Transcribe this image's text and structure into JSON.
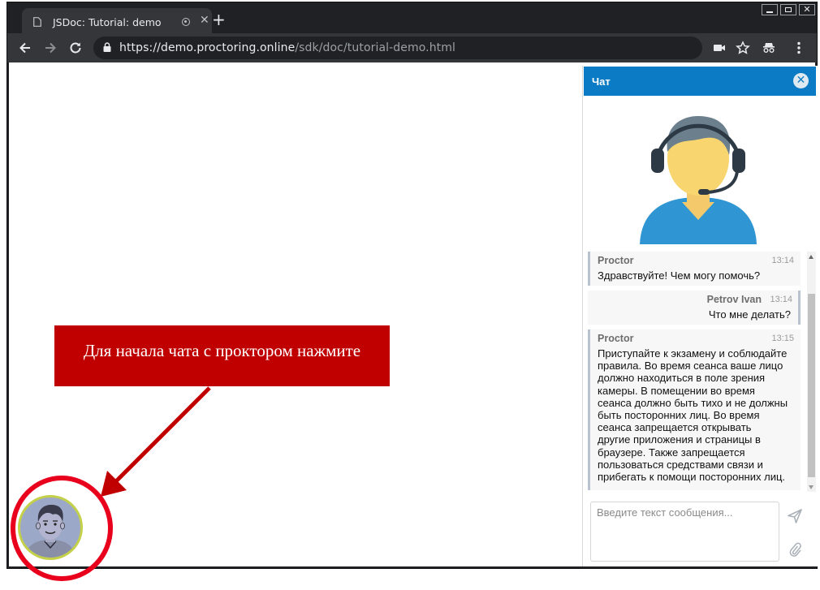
{
  "browser": {
    "tab_title": "JSDoc: Tutorial: demo",
    "new_tab_symbol": "+",
    "tab_close_symbol": "✕",
    "url_host": "https://demo.proctoring.online",
    "url_path": "/sdk/doc/tutorial-demo.html",
    "icons": [
      "document-icon",
      "recording-icon",
      "close-icon",
      "back-icon",
      "forward-icon",
      "reload-icon",
      "lock-icon",
      "camera-icon",
      "star-icon",
      "incognito-icon",
      "menu-icon"
    ]
  },
  "chat": {
    "title": "Чат",
    "close_symbol": "✕",
    "messages": [
      {
        "author": "Proctor",
        "time": "13:14",
        "side": "left",
        "lines": [
          "Здравствуйте! Чем могу помочь?"
        ]
      },
      {
        "author": "Petrov Ivan",
        "time": "13:14",
        "side": "right",
        "lines": [
          "Что мне делать?"
        ]
      },
      {
        "author": "Proctor",
        "time": "13:15",
        "side": "left",
        "lines": [
          "Приступайте к экзамену и соблюдайте",
          "правила. Во время сеанса ваше лицо",
          "должно находиться в поле зрения",
          "камеры. В помещении во время",
          "сеанса должно быть тихо и не должны",
          "быть посторонних лиц. Во время",
          "сеанса запрещается открывать",
          "другие приложения и страницы в",
          "браузере. Также запрещается",
          "пользоваться средствами связи и",
          "прибегать к помощи посторонних лиц."
        ]
      }
    ],
    "input_placeholder": "Введите текст сообщения...",
    "input_value": ""
  },
  "tutorial": {
    "callout_text": "Для начала чата с проктором нажмите",
    "callout_color": "#c00000",
    "highlight_color": "#e8001c"
  },
  "colors": {
    "chat_header": "#0a7bc4",
    "browser_dark": "#202124",
    "toolbar": "#35363a"
  }
}
